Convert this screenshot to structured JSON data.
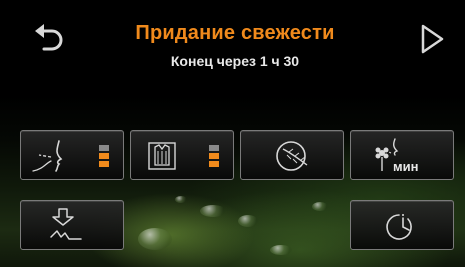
{
  "header": {
    "title": "Придание свежести",
    "subtitle": "Конец через 1 ч 30"
  },
  "colors": {
    "accent": "#f08a1c",
    "text": "#e8e8e8",
    "button_border": "#7a7a7a"
  },
  "buttons": [
    {
      "name": "odor-intensity-button",
      "icon": "nose-smell-icon",
      "level": 2,
      "max_level": 3
    },
    {
      "name": "garment-type-button",
      "icon": "clothes-on-hanger-icon",
      "level": 2,
      "max_level": 3
    },
    {
      "name": "delicate-fabric-button",
      "icon": "feather-icon"
    },
    {
      "name": "fragrance-time-button",
      "icon": "flower-scent-icon",
      "label": "мин"
    },
    {
      "name": "wrinkle-care-button",
      "icon": "steam-smooth-icon"
    },
    {
      "name": "delay-start-button",
      "icon": "timer-clock-icon"
    }
  ]
}
